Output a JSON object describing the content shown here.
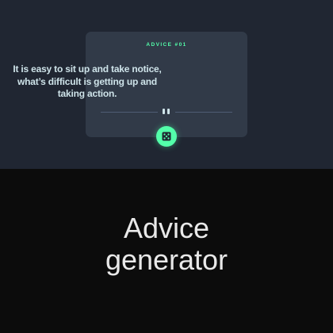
{
  "card": {
    "advice_id": "ADVICE #01",
    "quote": "It is easy to sit up and take notice, what’s difficult is getting up and taking action."
  },
  "dice_button": {
    "icon": "dice-icon"
  },
  "divider": {
    "icon": "pause-icon"
  },
  "caption": {
    "line1": "Advice",
    "line2": "generator"
  },
  "colors": {
    "preview_bg": "#202632",
    "card_bg": "#313a48",
    "accent": "#53ffaa",
    "text": "#cee3e9",
    "caption_bg": "#0c0c0c"
  }
}
